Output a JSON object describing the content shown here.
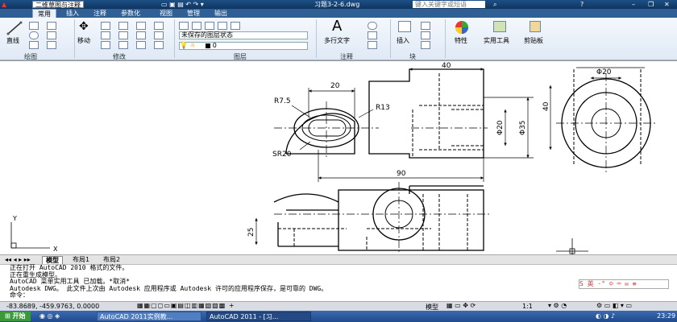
{
  "title": {
    "workspace": "二维草图与注释",
    "file": "习题3-2-6.dwg",
    "search_placeholder": "键入关键字或短语"
  },
  "tabs": [
    "常用",
    "插入",
    "注释",
    "参数化",
    "视图",
    "管理",
    "输出"
  ],
  "ribbon": {
    "line_label": "直线",
    "move_label": "移动",
    "layer_state": "未保存的图层状态",
    "layer_current": "0",
    "mtext_label": "多行文字",
    "insert_label": "插入",
    "properties_label": "特性",
    "utilities_label": "实用工具",
    "clipboard_label": "剪贴板",
    "panels": {
      "draw": "绘图",
      "modify": "修改",
      "layers": "图层",
      "annotation": "注释",
      "block": "块"
    }
  },
  "drawing": {
    "dims": [
      "R7.5",
      "20",
      "R13",
      "SR20",
      "40",
      "90",
      "Φ20",
      "Φ35",
      "40",
      "Φ20",
      "25"
    ],
    "axis_x": "X",
    "axis_y": "Y"
  },
  "layout_tabs": [
    "模型",
    "布局1",
    "布局2"
  ],
  "command_lines": [
    "正在打开 AutoCAD 2010 格式的文件。",
    "正在重生成模型。",
    "AutoCAD 菜单实用工具 已加载。*取消*",
    "Autodesk DWG。  此文件上次由 Autodesk 应用程序或 Autodesk 许可的应用程序保存，是可靠的 DWG。",
    "命令："
  ],
  "status": {
    "coords": "-83.8689, -459.9763, 0.0000",
    "model": "模型",
    "scale": "1:1"
  },
  "taskbar": {
    "start": "开始",
    "items": [
      "AutoCAD 2011实例教...",
      "AutoCAD 2011 - [习..."
    ],
    "clock": "23:29"
  }
}
